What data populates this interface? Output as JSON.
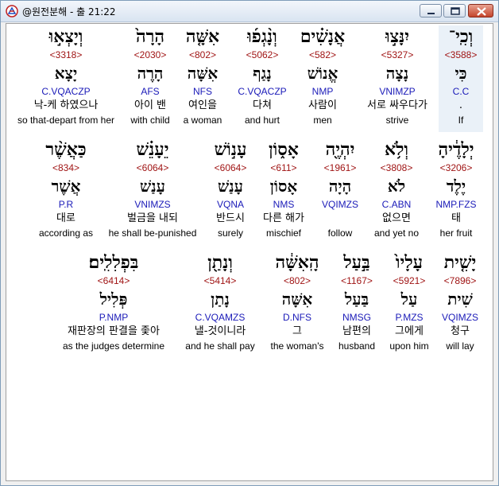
{
  "window": {
    "title": "@원전분해 - 출 21:22",
    "buttons": {
      "minimize": "minimize",
      "maximize": "maximize",
      "close": "close"
    }
  },
  "icons": {
    "app": "app-icon",
    "minimize": "minimize-icon",
    "maximize": "maximize-icon",
    "close": "close-icon"
  },
  "rows": [
    {
      "words": [
        {
          "heb": "וְכִֽי־",
          "strongs": "<3588>",
          "lemma": "כִּי",
          "morph": "C.C",
          "kor": ".",
          "eng": "If",
          "highlight": true
        },
        {
          "heb": "יִנָּצ֣וּ",
          "strongs": "<5327>",
          "lemma": "נָצָה",
          "morph": "VNIMZP",
          "kor": "서로 싸우다가",
          "eng": "strive"
        },
        {
          "heb": "אֲנָשִׁ֗ים",
          "strongs": "<582>",
          "lemma": "אֱנוֹשׁ",
          "morph": "NMP",
          "kor": "사람이",
          "eng": "men"
        },
        {
          "heb": "וְנָ֨גְפ֜וּ",
          "strongs": "<5062>",
          "lemma": "נָגַף",
          "morph": "C.VQACZP",
          "kor": "다쳐",
          "eng": "and hurt"
        },
        {
          "heb": "אִשָּׁ֤ה",
          "strongs": "<802>",
          "lemma": "אִשָּׁה",
          "morph": "NFS",
          "kor": "여인을",
          "eng": "a woman"
        },
        {
          "heb": "הָרָה֙",
          "strongs": "<2030>",
          "lemma": "הָרֶה",
          "morph": "AFS",
          "kor": "아이 밴",
          "eng": "with child"
        },
        {
          "heb": "וְיָצְא֣וּ",
          "strongs": "<3318>",
          "lemma": "יָצָא",
          "morph": "C.VQACZP",
          "kor": "낙-케 하였으나",
          "eng": "so that-depart from her"
        }
      ]
    },
    {
      "words": [
        {
          "heb": "יְלָדֶ֔יהָ",
          "strongs": "<3206>",
          "lemma": "יֶלֶד",
          "morph": "NMP.FZS",
          "kor": "태",
          "eng": "her fruit"
        },
        {
          "heb": "וְלֹ֥א",
          "strongs": "<3808>",
          "lemma": "לֹא",
          "morph": "C.ABN",
          "kor": "없으면",
          "eng": "and yet no"
        },
        {
          "heb": "יִהְיֶ֖ה",
          "strongs": "<1961>",
          "lemma": "הָיָה",
          "morph": "VQIMZS",
          "kor": "",
          "eng": "follow"
        },
        {
          "heb": "אָס֑וֹן",
          "strongs": "<611>",
          "lemma": "אָסוֹן",
          "morph": "NMS",
          "kor": "다른 해가",
          "eng": "mischief"
        },
        {
          "heb": "עָנ֣וֹשׁ",
          "strongs": "<6064>",
          "lemma": "עָנַשׁ",
          "morph": "VQNA",
          "kor": "반드시",
          "eng": "surely"
        },
        {
          "heb": "יֵעָנֵ֗שׁ",
          "strongs": "<6064>",
          "lemma": "עָנַשׁ",
          "morph": "VNIMZS",
          "kor": "벌금을 내되",
          "eng": "he shall be-punished"
        },
        {
          "heb": "כַּאֲשֶׁ֨ר",
          "strongs": "<834>",
          "lemma": "אֲשֶׁר",
          "morph": "P.R",
          "kor": "대로",
          "eng": "according as"
        }
      ]
    },
    {
      "words": [
        {
          "heb": "יָשִׁ֤ית",
          "strongs": "<7896>",
          "lemma": "שִׁית",
          "morph": "VQIMZS",
          "kor": "청구",
          "eng": "will lay"
        },
        {
          "heb": "עָלָיו֙",
          "strongs": "<5921>",
          "lemma": "עַל",
          "morph": "P.MZS",
          "kor": "그에게",
          "eng": "upon him"
        },
        {
          "heb": "בַּ֣עַל",
          "strongs": "<1167>",
          "lemma": "בַּעַל",
          "morph": "NMSG",
          "kor": "남편의",
          "eng": "husband"
        },
        {
          "heb": "הָֽאִשָּׁ֔ה",
          "strongs": "<802>",
          "lemma": "אִשָּׁה",
          "morph": "D.NFS",
          "kor": "그",
          "eng": "the woman's"
        },
        {
          "heb": "וְנָתַ֖ן",
          "strongs": "<5414>",
          "lemma": "נָתַן",
          "morph": "C.VQAMZS",
          "kor": "낼-것이니라",
          "eng": "and he shall pay"
        },
        {
          "heb": "בִּפְלִלִֽים׃",
          "strongs": "<6414>",
          "lemma": "פְּלִיל",
          "morph": "P.NMP",
          "kor": "재판장의 판결을 좇아",
          "eng": "as the judges determine"
        }
      ]
    }
  ]
}
